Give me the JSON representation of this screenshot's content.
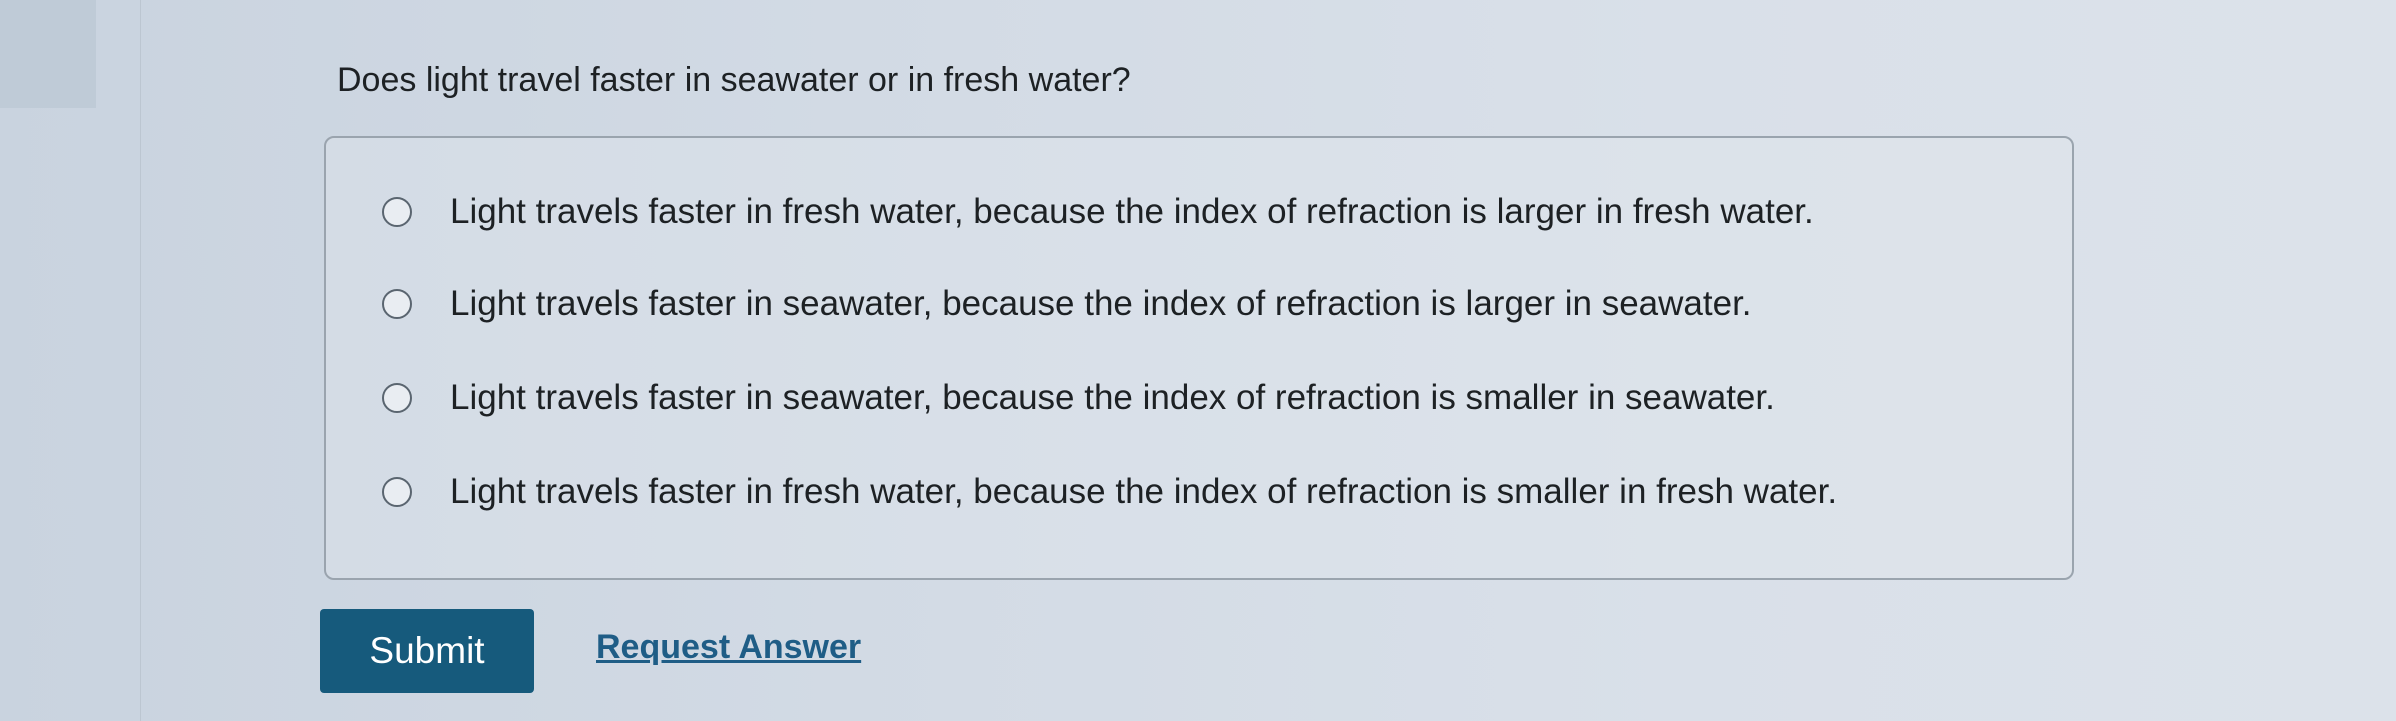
{
  "question": {
    "text": "Does light travel faster in seawater or in fresh water?"
  },
  "options": [
    {
      "label": "Light travels faster in fresh water, because the index of refraction is larger in fresh water.",
      "selected": false
    },
    {
      "label": "Light travels faster in seawater, because the index of refraction is larger in seawater.",
      "selected": false
    },
    {
      "label": "Light travels faster in seawater, because the index of refraction is smaller in seawater.",
      "selected": false
    },
    {
      "label": "Light travels faster in fresh water, because the index of refraction is smaller in fresh water.",
      "selected": false
    }
  ],
  "actions": {
    "submit_label": "Submit",
    "request_answer_label": "Request Answer"
  },
  "colors": {
    "submit_bg": "#165a7c",
    "link": "#1f5d86"
  }
}
